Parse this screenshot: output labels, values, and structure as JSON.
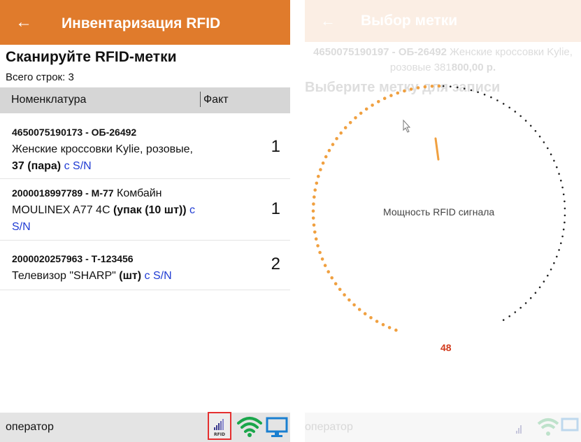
{
  "left": {
    "title": "Инвентаризация RFID",
    "back_icon": "←",
    "heading": "Сканируйте RFID-метки",
    "total_rows": "Всего строк: 3",
    "columns": {
      "name": "Номенклатура",
      "fact": "Факт"
    },
    "rows": [
      {
        "code": "4650075190173 - ОБ-26492",
        "name": "Женские кроссовки Kylie, розовые, ",
        "size": "37 (пара)",
        "sn": "с S/N",
        "qty": "1"
      },
      {
        "code": "2000018997789 - М-77",
        "name": " Комбайн MOULINEX A77 4C ",
        "unit": "(упак (10 шт))",
        "sn": "с S/N",
        "qty": "1"
      },
      {
        "code": "2000020257963 - Т-123456",
        "name": "Телевизор \"SHARP\" ",
        "unit": "(шт)",
        "sn": "с S/N",
        "qty": "2"
      }
    ],
    "footer": {
      "operator": "оператор",
      "rfid_label": "RFID"
    }
  },
  "right": {
    "title": "Выбор метки",
    "back_icon": "←",
    "item_code": "4650075190197 - ОБ-26492",
    "item_name": " Женские кроссовки Kylie, розовые 381",
    "item_price": "800,00 р.",
    "choose": "Выберите метку для записи",
    "power_label": "Мощность RFID сигнала",
    "power_value": "48",
    "footer": {
      "operator": "оператор"
    }
  },
  "colors": {
    "accent": "#E07B2C",
    "link": "#1f3bd3",
    "highlight": "#e53030",
    "wifi": "#1aa64b",
    "monitor": "#1a7fd0",
    "power_value": "#d23a1c"
  },
  "icons": [
    "arrow-left-icon",
    "rfid-icon",
    "wifi-icon",
    "monitor-icon"
  ]
}
